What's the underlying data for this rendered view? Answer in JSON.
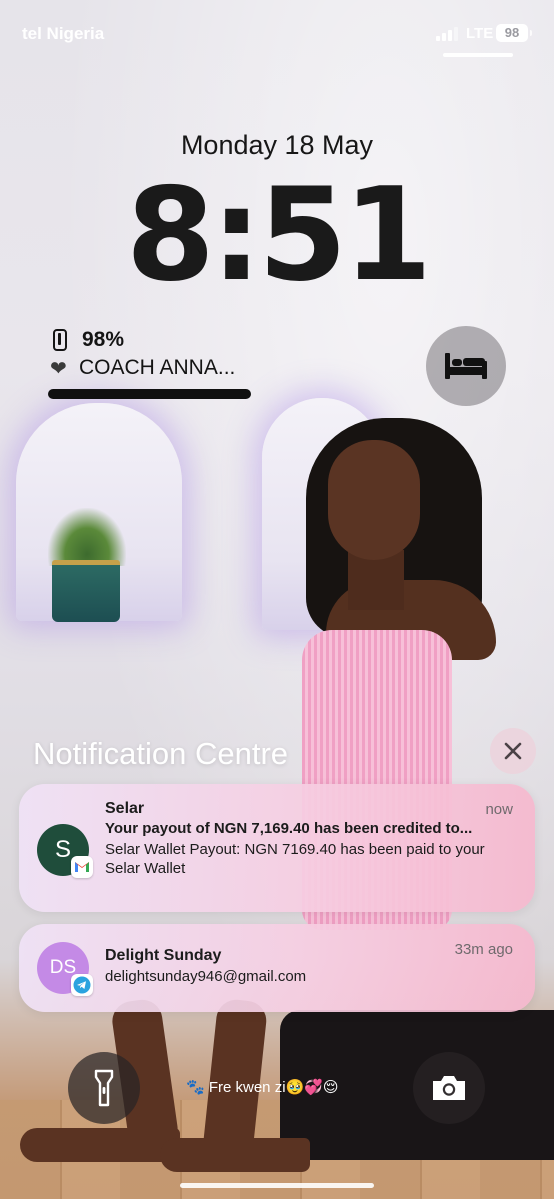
{
  "status_bar": {
    "carrier": "tel Nigeria",
    "network": "LTE",
    "battery": "98"
  },
  "lock_screen": {
    "date": "Monday 18 May",
    "time": "8:51"
  },
  "widget": {
    "battery_percent": "98%",
    "label": "COACH ANNA..."
  },
  "notification_centre": {
    "title": "Notification Centre",
    "notifications": [
      {
        "avatar": "S",
        "app_badge": "gmail-icon",
        "sender": "Selar",
        "time": "now",
        "subject": "Your payout of NGN 7,169.40 has been credited to...",
        "body": "Selar Wallet Payout: NGN 7169.40 has been paid to your Selar Wallet"
      },
      {
        "avatar": "DS",
        "app_badge": "telegram-icon",
        "sender": "Delight Sunday",
        "time": "33m ago",
        "body": "delightsunday946@gmail.com"
      }
    ]
  },
  "focus": {
    "text": "🐾 Fre kwen zi🥹💞😌"
  },
  "colors": {
    "gmail_red": "#ea4335",
    "telegram_blue": "#2aa3df",
    "selar_avatar": "#1f4d3b",
    "ds_avatar": "#c48ae6"
  }
}
